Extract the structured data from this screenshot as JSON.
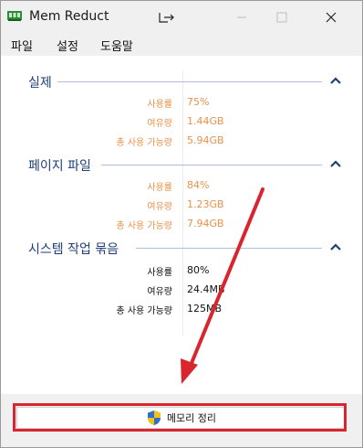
{
  "window": {
    "title": "Mem Reduct"
  },
  "menu": [
    "파일",
    "설정",
    "도움말"
  ],
  "sections": [
    {
      "title": "실제",
      "rows": [
        {
          "label": "사용률",
          "value": "75%"
        },
        {
          "label": "여유량",
          "value": "1.44GB"
        },
        {
          "label": "총 사용 가능량",
          "value": "5.94GB"
        }
      ]
    },
    {
      "title": "페이지 파일",
      "rows": [
        {
          "label": "사용률",
          "value": "84%"
        },
        {
          "label": "여유량",
          "value": "1.23GB"
        },
        {
          "label": "총 사용 가능량",
          "value": "7.94GB"
        }
      ]
    },
    {
      "title": "시스템 작업 묶음",
      "rows": [
        {
          "label": "사용률",
          "value": "80%"
        },
        {
          "label": "여유량",
          "value": "24.4MB"
        },
        {
          "label": "총 사용 가능량",
          "value": "125MB"
        }
      ]
    }
  ],
  "footer": {
    "clean_button": "메모리 정리"
  },
  "colors": {
    "accent_orange": "#e8924a",
    "section_blue": "#1f3f78",
    "highlight_red": "#d9262e"
  }
}
